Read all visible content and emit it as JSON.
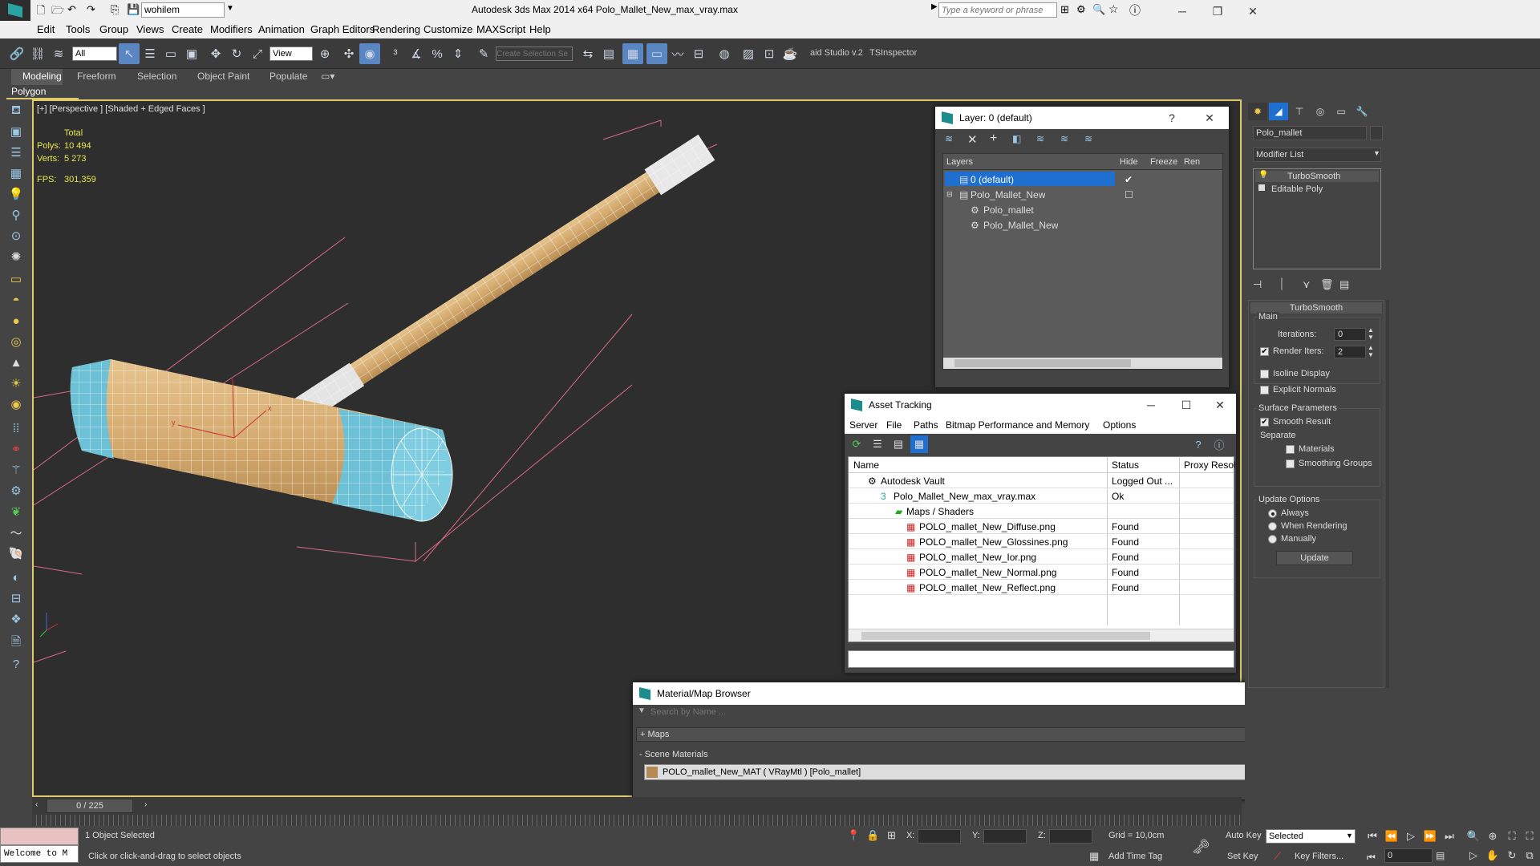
{
  "titlebar": {
    "workspace": "wohilem",
    "title": "Autodesk 3ds Max  2014 x64     Polo_Mallet_New_max_vray.max",
    "search_placeholder": "Type a keyword or phrase"
  },
  "menu": [
    "Edit",
    "Tools",
    "Group",
    "Views",
    "Create",
    "Modifiers",
    "Animation",
    "Graph Editors",
    "Rendering",
    "Customize",
    "MAXScript",
    "Help"
  ],
  "toolbar": {
    "filter_value": "All",
    "refcoord_value": "View",
    "selection_set_placeholder": "Create Selection Se",
    "plugin1": "aid Studio v.2",
    "plugin2": "TSInspector"
  },
  "ribbon": {
    "tabs": [
      "Modeling",
      "Freeform",
      "Selection",
      "Object Paint",
      "Populate"
    ],
    "panel": "Polygon Modeling"
  },
  "viewport": {
    "label": "[+] [Perspective ] [Shaded + Edged Faces ]",
    "stats": {
      "total_label": "Total",
      "polys_label": "Polys:",
      "polys_value": "10 494",
      "verts_label": "Verts:",
      "verts_value": "5 273",
      "fps_label": "FPS:",
      "fps_value": "301,359"
    }
  },
  "layer_window": {
    "title": "Layer: 0 (default)",
    "help": "?",
    "columns": [
      "Layers",
      "Hide",
      "Freeze",
      "Ren"
    ],
    "rows": [
      {
        "name": "0 (default)"
      },
      {
        "name": "Polo_Mallet_New"
      },
      {
        "name": "Polo_mallet"
      },
      {
        "name": "Polo_Mallet_New"
      }
    ]
  },
  "asset_window": {
    "title": "Asset Tracking",
    "menu": [
      "Server",
      "File",
      "Paths",
      "Bitmap Performance and Memory",
      "Options"
    ],
    "columns": [
      "Name",
      "Status",
      "Proxy Resol"
    ],
    "rows": [
      {
        "name": "Autodesk Vault",
        "status": "Logged Out ..."
      },
      {
        "name": "Polo_Mallet_New_max_vray.max",
        "status": "Ok"
      },
      {
        "name": "Maps / Shaders",
        "status": ""
      },
      {
        "name": "POLO_mallet_New_Diffuse.png",
        "status": "Found"
      },
      {
        "name": "POLO_mallet_New_Glossines.png",
        "status": "Found"
      },
      {
        "name": "POLO_mallet_New_Ior.png",
        "status": "Found"
      },
      {
        "name": "POLO_mallet_New_Normal.png",
        "status": "Found"
      },
      {
        "name": "POLO_mallet_New_Reflect.png",
        "status": "Found"
      }
    ]
  },
  "material_browser": {
    "title": "Material/Map Browser",
    "search_placeholder": "Search by Name ...",
    "maps_group": "+ Maps",
    "scene_group": "- Scene Materials",
    "material": "POLO_mallet_New_MAT  ( VRayMtl )  [Polo_mallet]"
  },
  "command_panel": {
    "object_name": "Polo_mallet",
    "modifier_list": "Modifier List",
    "stack": [
      "TurboSmooth",
      "Editable Poly"
    ],
    "rollout_title": "TurboSmooth",
    "main_label": "Main",
    "iterations_label": "Iterations:",
    "iterations_value": "0",
    "render_iters_label": "Render Iters:",
    "render_iters_value": "2",
    "isoline_label": "Isoline Display",
    "explicit_label": "Explicit Normals",
    "surface_label": "Surface Parameters",
    "smooth_result_label": "Smooth Result",
    "separate_label": "Separate",
    "materials_label": "Materials",
    "smoothing_groups_label": "Smoothing Groups",
    "update_options_label": "Update Options",
    "always_label": "Always",
    "when_rendering_label": "When Rendering",
    "manually_label": "Manually",
    "update_button": "Update"
  },
  "timeline": {
    "frame": "0 / 225"
  },
  "status": {
    "maxscript_text": "Welcome to M",
    "selected": "1 Object Selected",
    "prompt": "Click or click-and-drag to select objects",
    "x_label": "X:",
    "y_label": "Y:",
    "z_label": "Z:",
    "grid": "Grid = 10,0cm",
    "add_time_tag": "Add Time Tag",
    "auto_key": "Auto Key",
    "set_key": "Set Key",
    "key_mode": "Selected",
    "key_filters": "Key Filters...",
    "frame_value": "0"
  },
  "colors": {
    "accent_blue": "#1e6fd0",
    "viewport_border": "#e0c96b",
    "wood": "#d9b27a",
    "cap_blue": "#6cc1d6"
  }
}
